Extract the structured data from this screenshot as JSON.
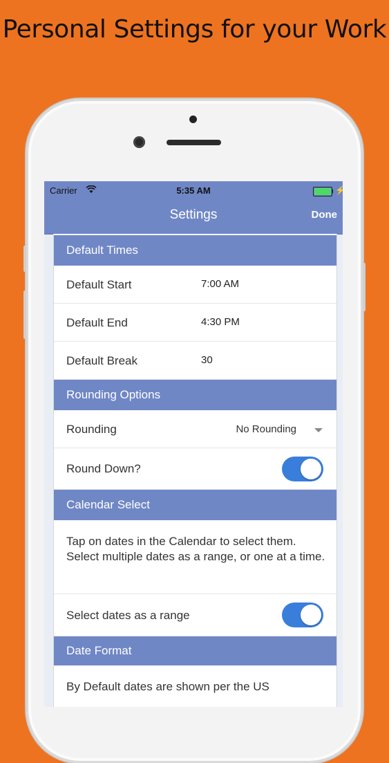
{
  "headline": "Personal Settings for your Work",
  "colors": {
    "background": "#EE7320",
    "accent": "#7087C6",
    "toggle_on": "#3A7EDB"
  },
  "status_bar": {
    "carrier": "Carrier",
    "wifi_icon": "wifi-icon",
    "time": "5:35 AM",
    "battery_icon": "battery-icon",
    "charging_icon": "charging-icon"
  },
  "nav": {
    "title": "Settings",
    "done_label": "Done"
  },
  "sections": {
    "default_times": {
      "header": "Default Times",
      "start_label": "Default Start",
      "start_value": "7:00 AM",
      "end_label": "Default End",
      "end_value": "4:30 PM",
      "break_label": "Default Break",
      "break_value": "30"
    },
    "rounding": {
      "header": "Rounding Options",
      "rounding_label": "Rounding",
      "rounding_value": "No Rounding",
      "round_down_label": "Round Down?",
      "round_down_on": true
    },
    "calendar": {
      "header": "Calendar Select",
      "description": "Tap on dates in the Calendar to select them. Select multiple dates as a range, or one at a time.",
      "range_label": "Select dates as a range",
      "range_on": true
    },
    "date_format": {
      "header": "Date Format",
      "description": "By Default dates are shown per the US"
    }
  }
}
